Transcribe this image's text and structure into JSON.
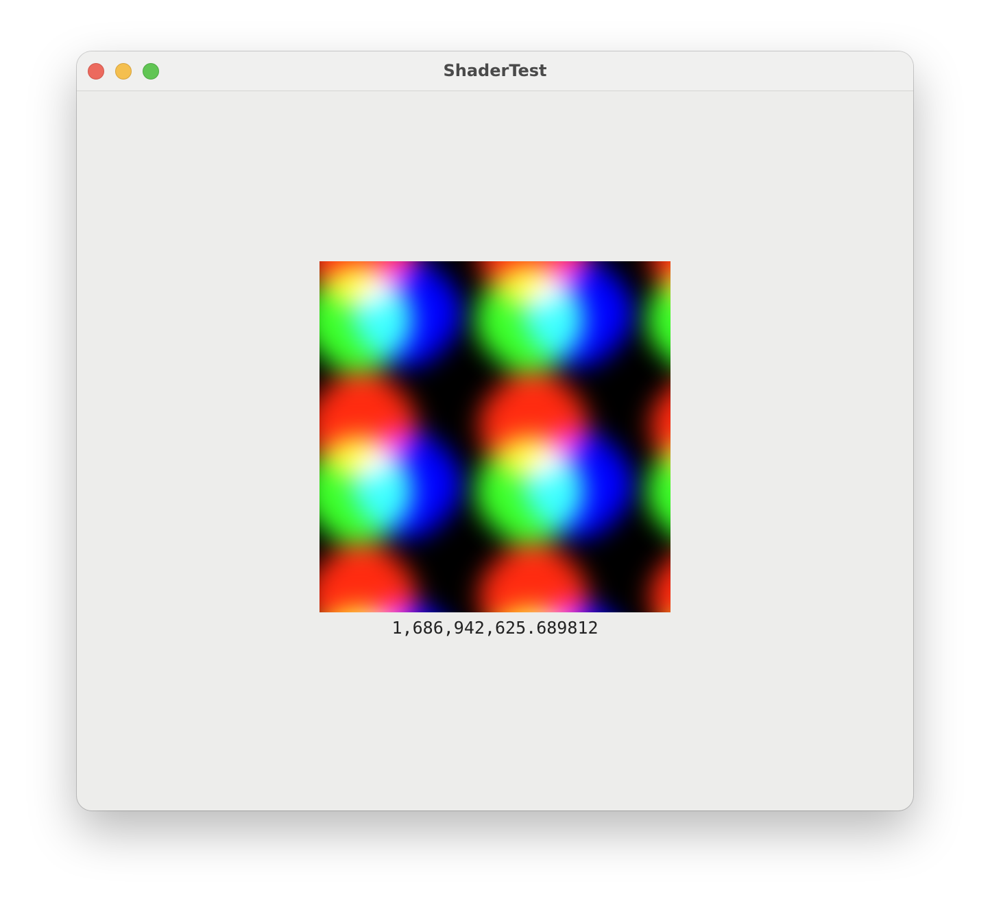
{
  "window": {
    "title": "ShaderTest",
    "controls": [
      "close-icon",
      "minimize-icon",
      "zoom-icon"
    ]
  },
  "shader_view": {
    "colors": {
      "red": "#ff2a10",
      "green": "#3cff28",
      "blue": "#0000ff",
      "background": "#000000"
    }
  },
  "readout": {
    "value": "1,686,942,625.689812"
  }
}
